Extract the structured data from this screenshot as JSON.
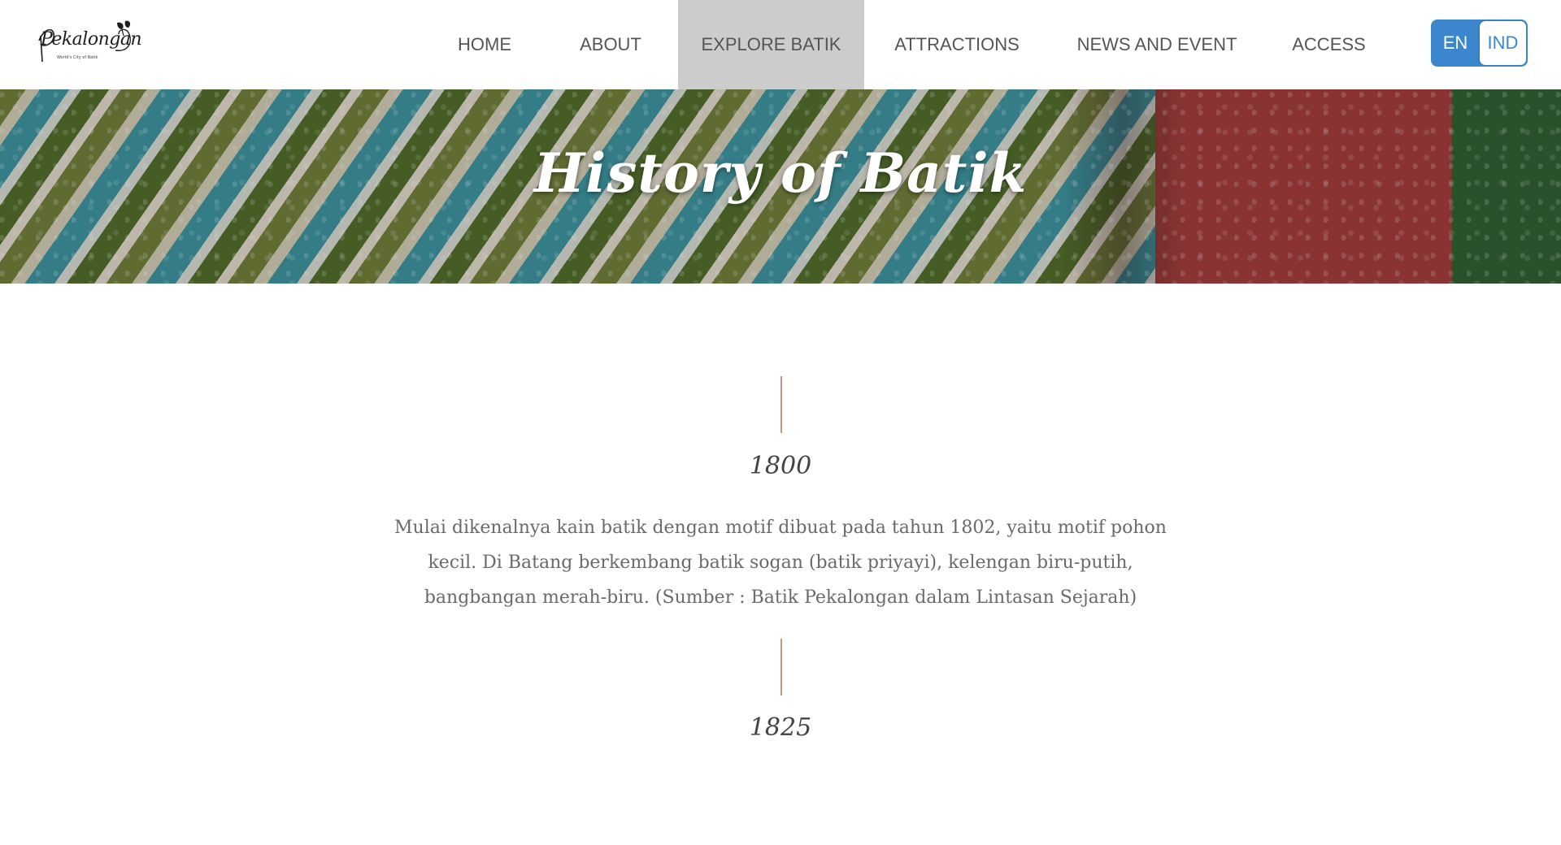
{
  "header": {
    "logo": {
      "text": "Pekalongan",
      "subtitle": "World's City of Batik"
    },
    "nav": [
      {
        "label": "HOME",
        "active": false
      },
      {
        "label": "ABOUT",
        "active": false
      },
      {
        "label": "EXPLORE BATIK",
        "active": true
      },
      {
        "label": "ATTRACTIONS",
        "active": false
      },
      {
        "label": "NEWS AND EVENT",
        "active": false
      },
      {
        "label": "ACCESS",
        "active": false
      }
    ],
    "language": {
      "en": "EN",
      "ind": "IND",
      "selected": "EN"
    }
  },
  "hero": {
    "title": "History of Batik"
  },
  "timeline": [
    {
      "year": "1800",
      "text": "Mulai dikenalnya kain batik dengan motif dibuat pada tahun 1802, yaitu motif pohon kecil. Di Batang berkembang batik sogan (batik priyayi), kelengan biru-putih, bangbangan merah-biru. (Sumber : Batik Pekalongan dalam Lintasan Sejarah)"
    },
    {
      "year": "1825",
      "text": ""
    }
  ],
  "colors": {
    "accent_blue": "#3b86cc",
    "active_nav_bg": "#cccccc",
    "timeline_line": "#b99887"
  }
}
